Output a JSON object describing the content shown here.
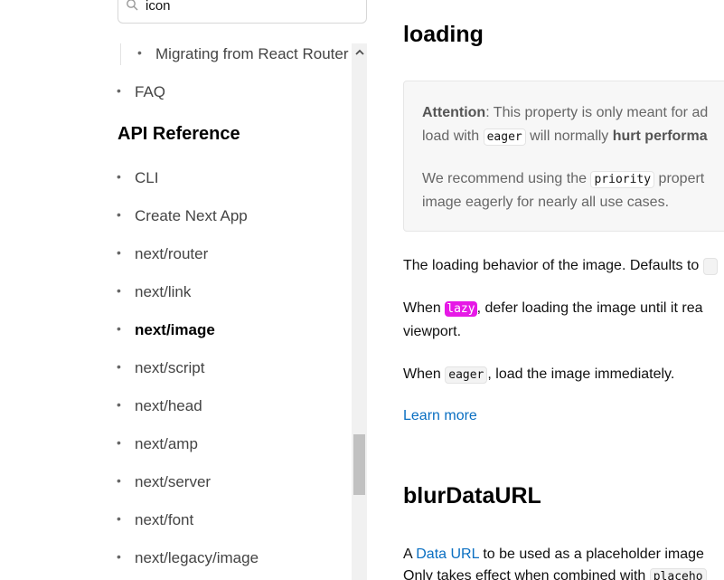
{
  "search": {
    "value": "icon"
  },
  "sidebar": {
    "nested_item": "Migrating from React Router",
    "faq": "FAQ",
    "section_heading": "API Reference",
    "items": [
      {
        "label": "CLI",
        "active": false
      },
      {
        "label": "Create Next App",
        "active": false
      },
      {
        "label": "next/router",
        "active": false
      },
      {
        "label": "next/link",
        "active": false
      },
      {
        "label": "next/image",
        "active": true
      },
      {
        "label": "next/script",
        "active": false
      },
      {
        "label": "next/head",
        "active": false
      },
      {
        "label": "next/amp",
        "active": false
      },
      {
        "label": "next/server",
        "active": false
      },
      {
        "label": "next/font",
        "active": false
      },
      {
        "label": "next/legacy/image",
        "active": false
      }
    ]
  },
  "main": {
    "loading_heading": "loading",
    "note": {
      "line1_bold": "Attention",
      "line1_rest": ": This property is only meant for ad",
      "line2_pre": "load with ",
      "line2_code": "eager",
      "line2_mid": " will normally ",
      "line2_bold": "hurt performa",
      "line3_pre": "We recommend using the ",
      "line3_code": "priority",
      "line3_rest": " propert",
      "line4": "image eagerly for nearly all use cases."
    },
    "p1": "The loading behavior of the image. Defaults to",
    "p2_pre": "When ",
    "p2_code": "lazy",
    "p2_rest": ", defer loading the image until it rea",
    "p2_line2": "viewport.",
    "p3_pre": "When ",
    "p3_code": "eager",
    "p3_rest": ", load the image immediately.",
    "learn_more": "Learn more",
    "blur_heading": "blurDataURL",
    "p4_pre": "A ",
    "p4_link": "Data URL",
    "p4_rest": " to be used as a placeholder image",
    "p5_pre": "Only takes effect when combined with ",
    "p5_code": "placeho"
  },
  "colors": {
    "highlight": "#e619e6",
    "link": "#0a6fc2"
  }
}
